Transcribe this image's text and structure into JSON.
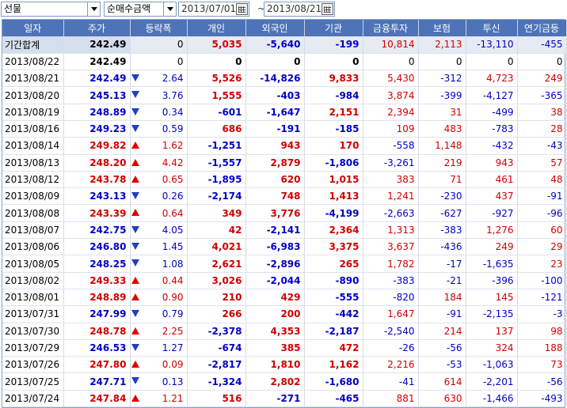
{
  "toolbar": {
    "market_select": "선물",
    "type_select": "순매수금액",
    "date_from": "2013/07/01",
    "date_to": "2013/08/21",
    "separator": "~"
  },
  "columns": [
    "일자",
    "주가",
    "등락폭",
    "개인",
    "외국인",
    "기관",
    "금융투자",
    "보험",
    "투신",
    "연기금등"
  ],
  "colors": {
    "header_bg": "#4e73b8",
    "up": "#d00000",
    "down": "#0000c8",
    "total_bg": "#e6ebf3"
  },
  "rows": [
    {
      "date": "기간합계",
      "price": "242.49",
      "dir": "",
      "chg": "0",
      "personal": "5,035",
      "foreign": "-5,640",
      "inst": "-199",
      "fin": "10,814",
      "ins": "2,113",
      "trust": "-13,110",
      "pension": "-455",
      "total": true
    },
    {
      "date": "2013/08/22",
      "price": "242.49",
      "dir": "",
      "chg": "0",
      "personal": "0",
      "foreign": "0",
      "inst": "0",
      "fin": "0",
      "ins": "0",
      "trust": "0",
      "pension": "0"
    },
    {
      "date": "2013/08/21",
      "price": "242.49",
      "dir": "dn",
      "chg": "2.64",
      "personal": "5,526",
      "foreign": "-14,826",
      "inst": "9,833",
      "fin": "5,430",
      "ins": "-312",
      "trust": "4,723",
      "pension": "249"
    },
    {
      "date": "2013/08/20",
      "price": "245.13",
      "dir": "dn",
      "chg": "3.76",
      "personal": "1,555",
      "foreign": "-403",
      "inst": "-984",
      "fin": "3,874",
      "ins": "-399",
      "trust": "-4,127",
      "pension": "-365"
    },
    {
      "date": "2013/08/19",
      "price": "248.89",
      "dir": "dn",
      "chg": "0.34",
      "personal": "-601",
      "foreign": "-1,647",
      "inst": "2,151",
      "fin": "2,394",
      "ins": "31",
      "trust": "-499",
      "pension": "38"
    },
    {
      "date": "2013/08/16",
      "price": "249.23",
      "dir": "dn",
      "chg": "0.59",
      "personal": "686",
      "foreign": "-191",
      "inst": "-185",
      "fin": "109",
      "ins": "483",
      "trust": "-783",
      "pension": "28"
    },
    {
      "date": "2013/08/14",
      "price": "249.82",
      "dir": "up",
      "chg": "1.62",
      "personal": "-1,251",
      "foreign": "943",
      "inst": "170",
      "fin": "-558",
      "ins": "1,148",
      "trust": "-432",
      "pension": "-43"
    },
    {
      "date": "2013/08/13",
      "price": "248.20",
      "dir": "up",
      "chg": "4.42",
      "personal": "-1,557",
      "foreign": "2,879",
      "inst": "-1,806",
      "fin": "-3,261",
      "ins": "219",
      "trust": "943",
      "pension": "57"
    },
    {
      "date": "2013/08/12",
      "price": "243.78",
      "dir": "up",
      "chg": "0.65",
      "personal": "-1,895",
      "foreign": "620",
      "inst": "1,015",
      "fin": "383",
      "ins": "71",
      "trust": "461",
      "pension": "48"
    },
    {
      "date": "2013/08/09",
      "price": "243.13",
      "dir": "dn",
      "chg": "0.26",
      "personal": "-2,174",
      "foreign": "748",
      "inst": "1,413",
      "fin": "1,241",
      "ins": "-230",
      "trust": "437",
      "pension": "-91"
    },
    {
      "date": "2013/08/08",
      "price": "243.39",
      "dir": "up",
      "chg": "0.64",
      "personal": "349",
      "foreign": "3,776",
      "inst": "-4,199",
      "fin": "-2,663",
      "ins": "-627",
      "trust": "-927",
      "pension": "-96"
    },
    {
      "date": "2013/08/07",
      "price": "242.75",
      "dir": "dn",
      "chg": "4.05",
      "personal": "42",
      "foreign": "-2,141",
      "inst": "2,364",
      "fin": "1,313",
      "ins": "-383",
      "trust": "1,276",
      "pension": "60"
    },
    {
      "date": "2013/08/06",
      "price": "246.80",
      "dir": "dn",
      "chg": "1.45",
      "personal": "4,021",
      "foreign": "-6,983",
      "inst": "3,375",
      "fin": "3,637",
      "ins": "-436",
      "trust": "249",
      "pension": "29"
    },
    {
      "date": "2013/08/05",
      "price": "248.25",
      "dir": "dn",
      "chg": "1.08",
      "personal": "2,621",
      "foreign": "-2,896",
      "inst": "265",
      "fin": "1,782",
      "ins": "-17",
      "trust": "-1,635",
      "pension": "23"
    },
    {
      "date": "2013/08/02",
      "price": "249.33",
      "dir": "up",
      "chg": "0.44",
      "personal": "3,026",
      "foreign": "-2,044",
      "inst": "-890",
      "fin": "-383",
      "ins": "-21",
      "trust": "-396",
      "pension": "-100"
    },
    {
      "date": "2013/08/01",
      "price": "248.89",
      "dir": "up",
      "chg": "0.90",
      "personal": "210",
      "foreign": "429",
      "inst": "-555",
      "fin": "-820",
      "ins": "184",
      "trust": "145",
      "pension": "-121"
    },
    {
      "date": "2013/07/31",
      "price": "247.99",
      "dir": "dn",
      "chg": "0.79",
      "personal": "266",
      "foreign": "200",
      "inst": "-442",
      "fin": "1,647",
      "ins": "-91",
      "trust": "-2,135",
      "pension": "-3"
    },
    {
      "date": "2013/07/30",
      "price": "248.78",
      "dir": "up",
      "chg": "2.25",
      "personal": "-2,378",
      "foreign": "4,353",
      "inst": "-2,187",
      "fin": "-2,540",
      "ins": "214",
      "trust": "137",
      "pension": "98"
    },
    {
      "date": "2013/07/29",
      "price": "246.53",
      "dir": "dn",
      "chg": "1.27",
      "personal": "-674",
      "foreign": "385",
      "inst": "472",
      "fin": "-26",
      "ins": "-56",
      "trust": "324",
      "pension": "188"
    },
    {
      "date": "2013/07/26",
      "price": "247.80",
      "dir": "up",
      "chg": "0.09",
      "personal": "-2,817",
      "foreign": "1,810",
      "inst": "1,162",
      "fin": "2,216",
      "ins": "-53",
      "trust": "-1,063",
      "pension": "73"
    },
    {
      "date": "2013/07/25",
      "price": "247.71",
      "dir": "dn",
      "chg": "0.13",
      "personal": "-1,324",
      "foreign": "2,802",
      "inst": "-1,680",
      "fin": "-41",
      "ins": "614",
      "trust": "-2,201",
      "pension": "-56"
    },
    {
      "date": "2013/07/24",
      "price": "247.84",
      "dir": "up",
      "chg": "1.21",
      "personal": "516",
      "foreign": "-271",
      "inst": "-465",
      "fin": "881",
      "ins": "630",
      "trust": "-1,466",
      "pension": "-493"
    }
  ]
}
